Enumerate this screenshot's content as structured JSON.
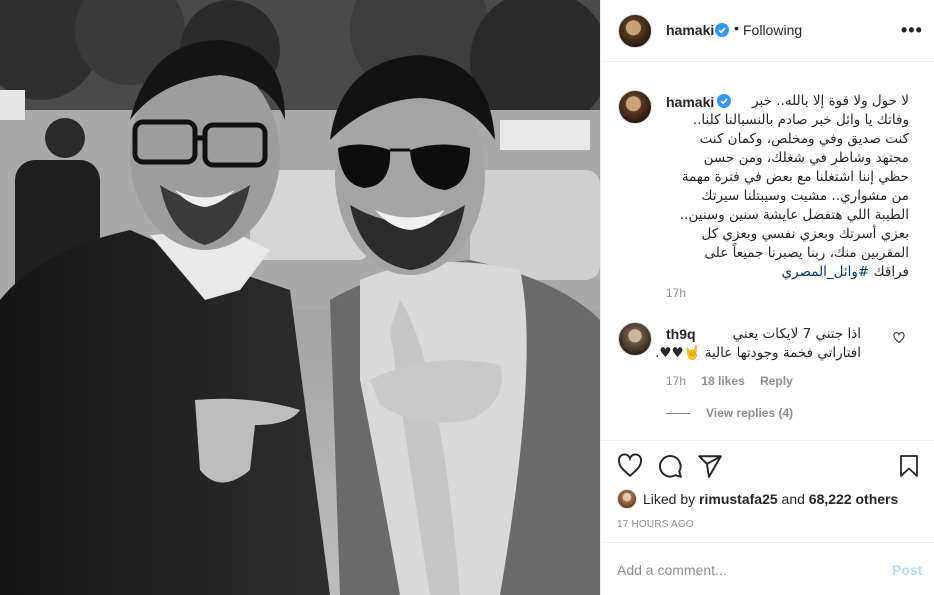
{
  "post": {
    "username": "hamaki",
    "separator": "•",
    "follow_status": "Following",
    "more_label": "•••"
  },
  "caption": {
    "username": "hamaki",
    "lines": [
      "لا حول ولا قوة إلا بالله.. خبر",
      "وفاتك يا وائل خبر صادم بالنسبالنا كلنا..",
      "كنت صديق وفي ومخلص، وكمان كنت",
      "مجتهد وشاطر في شغلك، ومن حسن",
      "حظي إننا اشتغلنا مع بعض في فترة مهمة",
      "من مشواري.. مشيت وسيبتلنا سيرتك",
      "الطيبة اللي هتفضل عايشة سنين وسنين..",
      "بعزي أسرتك وبعزي نفسي وبعزي كل",
      "المقربين منك، ربنا يصبرنا جميعاً على"
    ],
    "last_line_prefix": "فراقك",
    "hashtag": "#وائل_المصري",
    "time": "17h"
  },
  "comment": {
    "username": "th9q",
    "lines": [
      "اذا جتني 7 لايكات يعني",
      "افتاراتي فخمة وجودتها عالية 🤘♥♥."
    ],
    "time": "17h",
    "likes": "18 likes",
    "reply_label": "Reply",
    "view_replies": "View replies (4)"
  },
  "likes": {
    "prefix": "Liked by",
    "user": "rimustafa25",
    "conj": "and",
    "others": "68,222 others"
  },
  "post_time": "17 HOURS AGO",
  "add_comment": {
    "placeholder": "Add a comment...",
    "post_label": "Post"
  },
  "icons": {
    "verified": "verified-badge-icon",
    "like": "heart-icon",
    "comment": "comment-icon",
    "share": "paper-plane-icon",
    "save": "bookmark-icon",
    "more": "more-options-icon"
  },
  "colors": {
    "verified_blue": "#3897f0",
    "link_blue": "#00376b",
    "post_disabled": "#b2dffc",
    "secondary_text": "#8e8e8e"
  }
}
